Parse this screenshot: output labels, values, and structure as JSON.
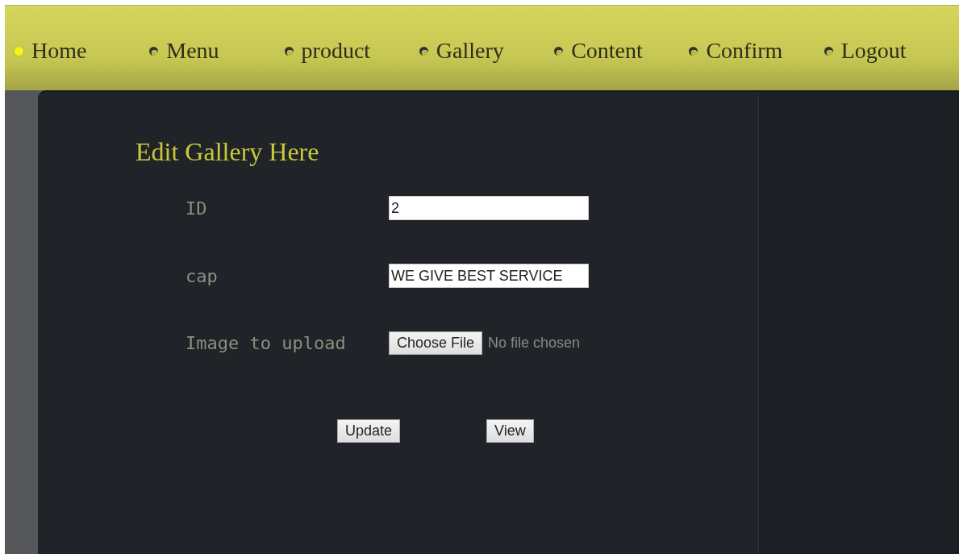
{
  "nav": [
    {
      "label": "Home",
      "selected": true
    },
    {
      "label": "Menu",
      "selected": false
    },
    {
      "label": "product",
      "selected": false
    },
    {
      "label": "Gallery",
      "selected": false
    },
    {
      "label": "Content",
      "selected": false
    },
    {
      "label": "Confirm",
      "selected": false
    },
    {
      "label": "Logout",
      "selected": false
    }
  ],
  "title": "Edit Gallery Here",
  "fields": [
    {
      "kind": "text",
      "label": "ID",
      "value": "2"
    },
    {
      "kind": "text",
      "label": "cap",
      "value": "WE GIVE BEST SERVICE"
    },
    {
      "kind": "file",
      "label": "Image to upload",
      "button": "Choose File",
      "status": "No file chosen"
    }
  ],
  "buttons": [
    "Update",
    "View"
  ]
}
